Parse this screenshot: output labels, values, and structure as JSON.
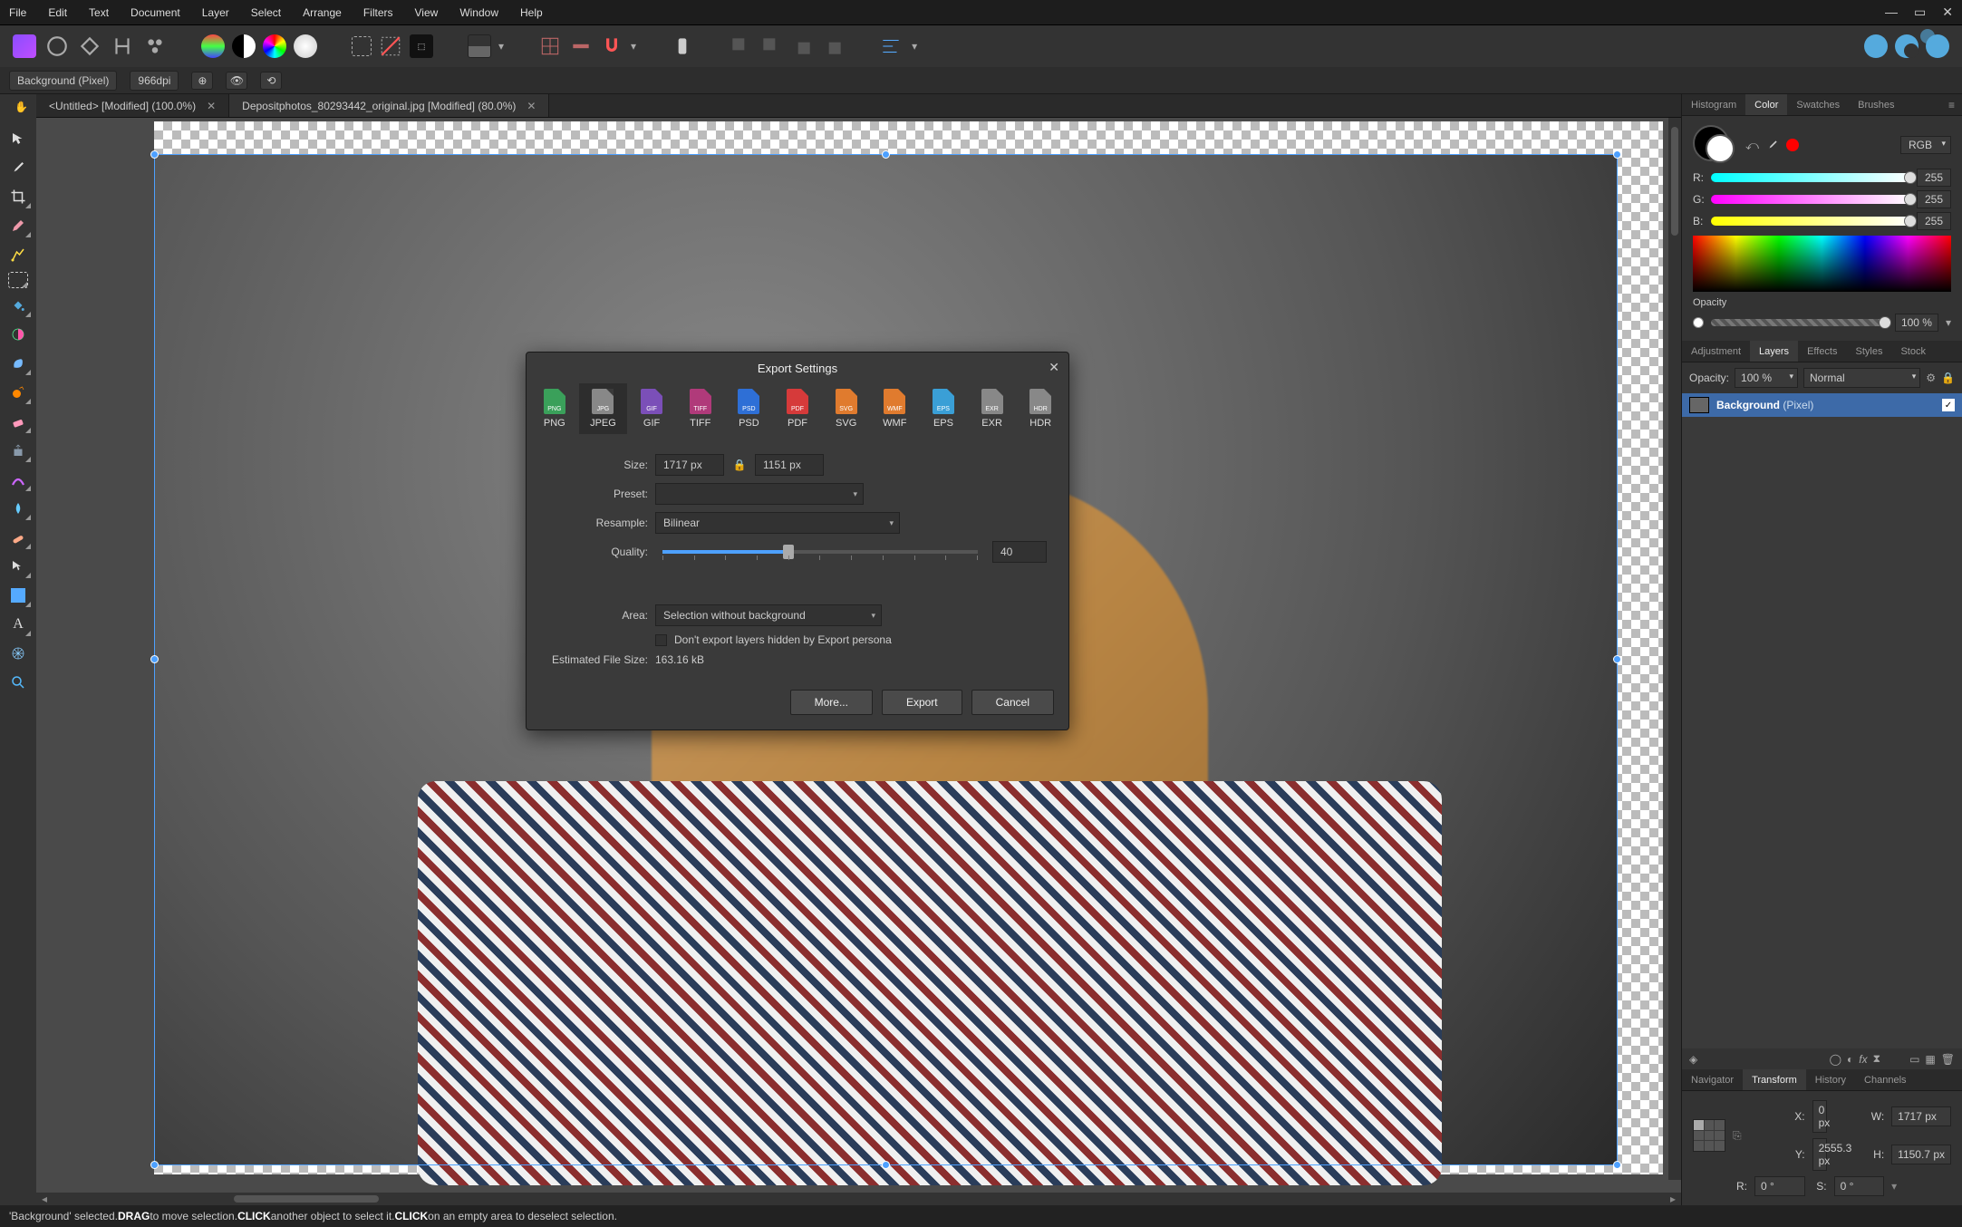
{
  "menu": [
    "File",
    "Edit",
    "Text",
    "Document",
    "Layer",
    "Select",
    "Arrange",
    "Filters",
    "View",
    "Window",
    "Help"
  ],
  "context": {
    "layer_name": "Background (Pixel)",
    "dpi": "966dpi"
  },
  "tabs": [
    {
      "label": "<Untitled> [Modified] (100.0%)",
      "active": false
    },
    {
      "label": "Depositphotos_80293442_original.jpg [Modified] (80.0%)",
      "active": true
    }
  ],
  "right": {
    "top_tabs": [
      "Histogram",
      "Color",
      "Swatches",
      "Brushes"
    ],
    "top_active": 1,
    "color_mode": "RGB",
    "channels": [
      {
        "label": "R:",
        "value": "255",
        "gradient": "linear-gradient(to right,#00ffff,#ffffff)"
      },
      {
        "label": "G:",
        "value": "255",
        "gradient": "linear-gradient(to right,#ff00ff,#ffffff)"
      },
      {
        "label": "B:",
        "value": "255",
        "gradient": "linear-gradient(to right,#ffff00,#ffffff)"
      }
    ],
    "opacity_label": "Opacity",
    "opacity_value": "100 %",
    "mid_tabs": [
      "Adjustment",
      "Layers",
      "Effects",
      "Styles",
      "Stock"
    ],
    "mid_active": 1,
    "layer_opacity_label": "Opacity:",
    "layer_opacity_value": "100 %",
    "blend_mode": "Normal",
    "layer": {
      "name": "Background",
      "type": "(Pixel)"
    },
    "bot_tabs": [
      "Navigator",
      "Transform",
      "History",
      "Channels"
    ],
    "bot_active": 1,
    "transform": {
      "x_label": "X:",
      "x": "0 px",
      "y_label": "Y:",
      "y": "2555.3 px",
      "w_label": "W:",
      "w": "1717 px",
      "h_label": "H:",
      "h": "1150.7 px",
      "r_label": "R:",
      "r": "0 °",
      "s_label": "S:",
      "s": "0 °"
    }
  },
  "dialog": {
    "title": "Export Settings",
    "formats": [
      {
        "label": "PNG",
        "badge": "PNG",
        "color": "#3aa05a"
      },
      {
        "label": "JPEG",
        "badge": "JPG",
        "color": "#888888"
      },
      {
        "label": "GIF",
        "badge": "GIF",
        "color": "#7b4fb8"
      },
      {
        "label": "TIFF",
        "badge": "TIFF",
        "color": "#b03a7a"
      },
      {
        "label": "PSD",
        "badge": "PSD",
        "color": "#2e6fd6"
      },
      {
        "label": "PDF",
        "badge": "PDF",
        "color": "#d63a3a"
      },
      {
        "label": "SVG",
        "badge": "SVG",
        "color": "#e07b2e"
      },
      {
        "label": "WMF",
        "badge": "WMF",
        "color": "#e07b2e"
      },
      {
        "label": "EPS",
        "badge": "EPS",
        "color": "#3a9fd6"
      },
      {
        "label": "EXR",
        "badge": "EXR",
        "color": "#888888"
      },
      {
        "label": "HDR",
        "badge": "HDR",
        "color": "#888888"
      }
    ],
    "selected_format": 1,
    "labels": {
      "size": "Size:",
      "preset": "Preset:",
      "resample": "Resample:",
      "quality": "Quality:",
      "area": "Area:",
      "dont_export": "Don't export layers hidden by Export persona",
      "est_label": "Estimated File Size:"
    },
    "size_w": "1717 px",
    "size_h": "1151 px",
    "preset": "",
    "resample": "Bilinear",
    "quality": "40",
    "quality_pct": 40,
    "area": "Selection without background",
    "est_value": "163.16 kB",
    "buttons": {
      "more": "More...",
      "export": "Export",
      "cancel": "Cancel"
    }
  },
  "status": {
    "p1": "'Background' selected. ",
    "b1": "DRAG",
    "p2": " to move selection. ",
    "b2": "CLICK",
    "p3": " another object to select it. ",
    "b3": "CLICK",
    "p4": " on an empty area to deselect selection."
  }
}
